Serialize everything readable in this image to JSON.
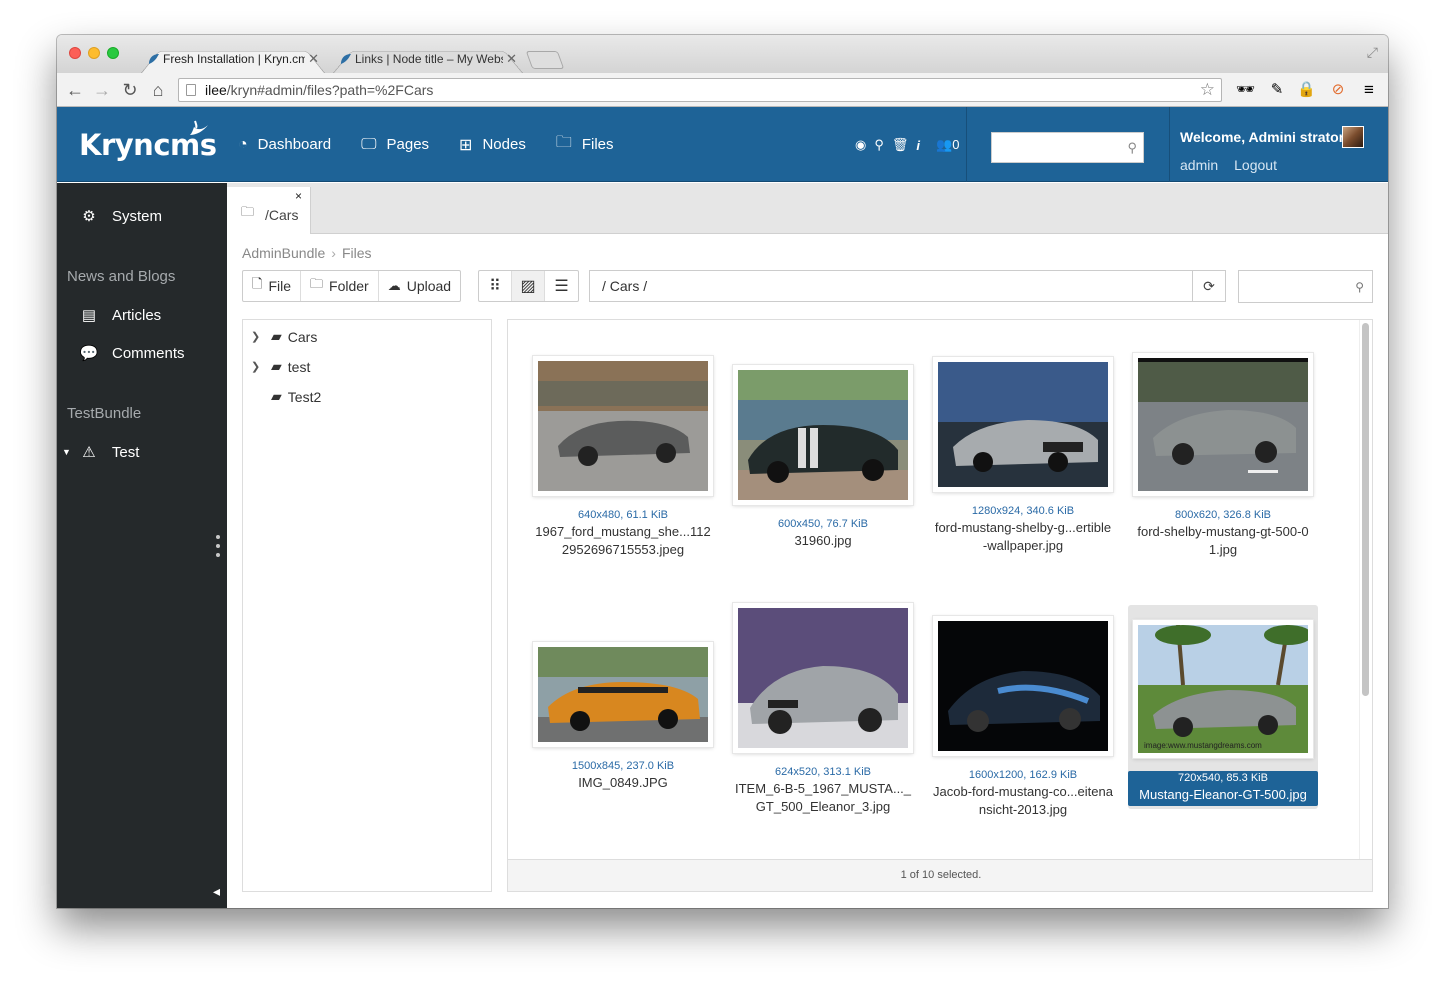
{
  "browser": {
    "tabs": [
      {
        "title": "Fresh Installation | Kryn.cms",
        "active": true
      },
      {
        "title": "Links | Node title – My Website",
        "active": false
      }
    ],
    "url_host": "ilee",
    "url_path": "/kryn#admin/files?path=%2FCars"
  },
  "header": {
    "logo": "Kryncms",
    "nav": [
      {
        "label": "Dashboard",
        "icon": "dashboard-icon"
      },
      {
        "label": "Pages",
        "icon": "monitor-icon"
      },
      {
        "label": "Nodes",
        "icon": "sitemap-icon"
      },
      {
        "label": "Files",
        "icon": "folder-icon"
      }
    ],
    "users_online": "0",
    "search_placeholder": "",
    "welcome": "Welcome, Admini strator",
    "username": "admin",
    "logout": "Logout"
  },
  "sidebar": {
    "system": "System",
    "group_news": "News and Blogs",
    "articles": "Articles",
    "comments": "Comments",
    "group_test": "TestBundle",
    "test": "Test"
  },
  "content": {
    "tab_label": "/Cars",
    "tab_close": "×",
    "breadcrumb": [
      "AdminBundle",
      "Files"
    ],
    "actions": {
      "file": "File",
      "folder": "Folder",
      "upload": "Upload"
    },
    "path": "/  Cars /",
    "tree": [
      {
        "label": "Cars",
        "expandable": true
      },
      {
        "label": "test",
        "expandable": true
      },
      {
        "label": "Test2",
        "expandable": false
      }
    ],
    "files": [
      {
        "meta": "640x480, 61.1 KiB",
        "name": "1967_ford_mustang_she...1122952696715553.jpeg"
      },
      {
        "meta": "600x450, 76.7 KiB",
        "name": "31960.jpg"
      },
      {
        "meta": "1280x924, 340.6 KiB",
        "name": "ford-mustang-shelby-g...ertible-wallpaper.jpg"
      },
      {
        "meta": "800x620, 326.8 KiB",
        "name": "ford-shelby-mustang-gt-500-01.jpg"
      },
      {
        "meta": "1500x845, 237.0 KiB",
        "name": "IMG_0849.JPG"
      },
      {
        "meta": "624x520, 313.1 KiB",
        "name": "ITEM_6-B-5_1967_MUSTA..._GT_500_Eleanor_3.jpg"
      },
      {
        "meta": "1600x1200, 162.9 KiB",
        "name": "Jacob-ford-mustang-co...eitenansicht-2013.jpg"
      },
      {
        "meta": "720x540, 85.3 KiB",
        "name": "Mustang-Eleanor-GT-500.jpg",
        "selected": true
      }
    ],
    "status": "1 of 10 selected.",
    "watermark": "image:www.mustangdreams.com"
  },
  "colors": {
    "brand": "#1e6397",
    "sidebar": "#25292b",
    "link": "#2a6aa6"
  }
}
